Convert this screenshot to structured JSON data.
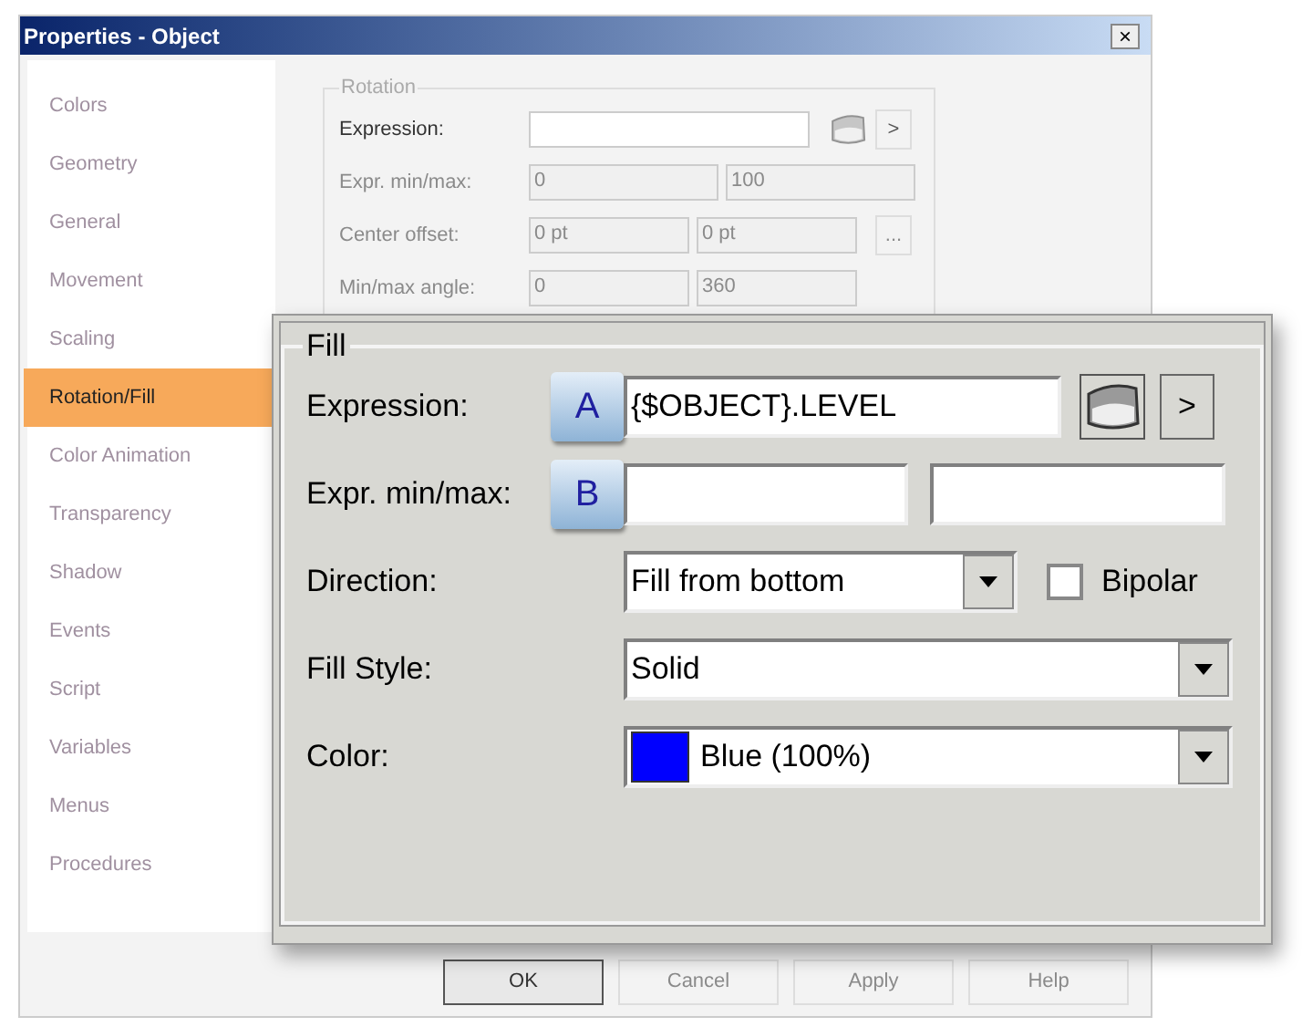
{
  "window": {
    "title": "Properties - Object",
    "close": "×"
  },
  "sidebar": {
    "items": [
      {
        "label": "Colors",
        "selected": false
      },
      {
        "label": "Geometry",
        "selected": false
      },
      {
        "label": "General",
        "selected": false
      },
      {
        "label": "Movement",
        "selected": false
      },
      {
        "label": "Scaling",
        "selected": false
      },
      {
        "label": "Rotation/Fill",
        "selected": true
      },
      {
        "label": "Color Animation",
        "selected": false
      },
      {
        "label": "Transparency",
        "selected": false
      },
      {
        "label": "Shadow",
        "selected": false
      },
      {
        "label": "Events",
        "selected": false
      },
      {
        "label": "Script",
        "selected": false
      },
      {
        "label": "Variables",
        "selected": false
      },
      {
        "label": "Menus",
        "selected": false
      },
      {
        "label": "Procedures",
        "selected": false
      }
    ]
  },
  "rotation": {
    "title": "Rotation",
    "rows": [
      {
        "label": "Expression:",
        "disabled": false,
        "extra": ">"
      },
      {
        "label": "Expr. min/max:",
        "disabled": true,
        "values": [
          "0",
          "100"
        ]
      },
      {
        "label": "Center offset:",
        "disabled": true,
        "values": [
          "0 pt",
          "0 pt"
        ],
        "extra": "..."
      },
      {
        "label": "Min/max angle:",
        "disabled": true,
        "values": [
          "0",
          "360"
        ]
      }
    ]
  },
  "fill": {
    "title": "Fill",
    "expression": {
      "label": "Expression:",
      "badge": "A",
      "value": "{$OBJECT}.LEVEL",
      "more": ">"
    },
    "minmax": {
      "label": "Expr. min/max:",
      "badge": "B"
    },
    "direction": {
      "label": "Direction:",
      "value": "Fill from bottom",
      "bipolar_label": "Bipolar",
      "bipolar_checked": false
    },
    "fill_style": {
      "label": "Fill Style:",
      "value": "Solid"
    },
    "color": {
      "label": "Color:",
      "value": "Blue (100%)",
      "color": "#0000ff"
    }
  },
  "buttons": [
    {
      "label": "OK",
      "disabled": false
    },
    {
      "label": "Cancel",
      "disabled": true
    },
    {
      "label": "Apply",
      "disabled": true
    },
    {
      "label": "Help",
      "disabled": true
    }
  ]
}
